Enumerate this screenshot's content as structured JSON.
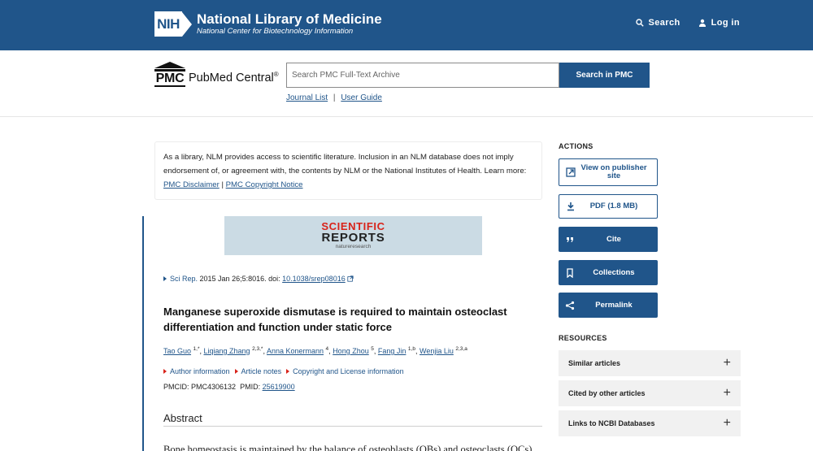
{
  "nih": {
    "logo": "NIH",
    "title": "National Library of Medicine",
    "subtitle": "National Center for Biotechnology Information",
    "search_label": "Search",
    "login_label": "Log in"
  },
  "pmc": {
    "logo_letters": "PMC",
    "name": "PubMed Central",
    "registered": "®",
    "search_placeholder": "Search PMC Full-Text Archive",
    "search_button": "Search in PMC",
    "journal_list": "Journal List",
    "separator": "|",
    "user_guide": "User Guide"
  },
  "disclaimer": {
    "text": "As a library, NLM provides access to scientific literature. Inclusion in an NLM database does not imply endorsement of, or agreement with, the contents by NLM or the National Institutes of Health.",
    "learn_more": "Learn more:",
    "link1": "PMC Disclaimer",
    "sep": "|",
    "link2": "PMC Copyright Notice"
  },
  "journal_banner": {
    "line1": "SCIENTIFIC",
    "line2": "REPORTS",
    "line3": "natureresearch"
  },
  "citation": {
    "journal": "Sci Rep.",
    "details": "2015 Jan 26;5:8016. doi:",
    "doi": "10.1038/srep08016"
  },
  "article": {
    "title": "Manganese superoxide dismutase is required to maintain osteoclast differentiation and function under static force",
    "authors": [
      {
        "name": "Tao Guo",
        "sup": "1,*"
      },
      {
        "name": "Liqiang Zhang",
        "sup": "2,3,*"
      },
      {
        "name": "Anna Konermann",
        "sup": "4"
      },
      {
        "name": "Hong Zhou",
        "sup": "5"
      },
      {
        "name": "Fang Jin",
        "sup": "1,b"
      },
      {
        "name": "Wenjia Liu",
        "sup": "2,3,a"
      }
    ],
    "links": [
      "Author information",
      "Article notes",
      "Copyright and License information"
    ],
    "pmcid_label": "PMCID: PMC4306132",
    "pmid_label": "PMID:",
    "pmid": "25619900",
    "abstract_heading": "Abstract",
    "abstract_start": "Bone homeostasis is maintained by the balance of osteoblasts (OBs) and osteoclasts (OCs)"
  },
  "sidebar": {
    "actions_heading": "ACTIONS",
    "view_publisher": "View on publisher site",
    "pdf": "PDF (1.8 MB)",
    "cite": "Cite",
    "collections": "Collections",
    "permalink": "Permalink",
    "resources_heading": "RESOURCES",
    "resources": [
      "Similar articles",
      "Cited by other articles",
      "Links to NCBI Databases"
    ],
    "plus": "+"
  },
  "colors": {
    "nih_blue": "#20558a",
    "accent_red": "#d8231a"
  }
}
